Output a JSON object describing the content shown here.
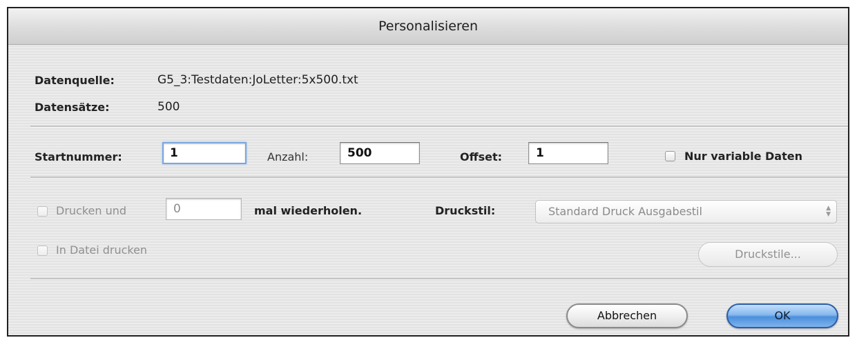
{
  "dialog": {
    "title": "Personalisieren",
    "datenquelle_label": "Datenquelle:",
    "datenquelle_value": "G5_3:Testdaten:JoLetter:5x500.txt",
    "datensaetze_label": "Datensätze:",
    "datensaetze_value": "500",
    "startnummer_label": "Startnummer:",
    "startnummer_value": "1",
    "anzahl_label": "Anzahl:",
    "anzahl_value": "500",
    "offset_label": "Offset:",
    "offset_value": "1",
    "nur_variable_label": "Nur variable Daten",
    "nur_variable_checked": false,
    "drucken_und_label": "Drucken und",
    "drucken_und_checked": false,
    "wiederholen_value": "0",
    "wiederholen_label": "mal wiederholen.",
    "druckstil_label": "Druckstil:",
    "druckstil_selected": "Standard Druck Ausgabestil",
    "in_datei_label": "In Datei drucken",
    "in_datei_checked": false,
    "druckstile_button": "Druckstile...",
    "cancel_button": "Abbrechen",
    "ok_button": "OK"
  },
  "icons": {
    "popup_arrows": "up-down-arrows-icon"
  }
}
